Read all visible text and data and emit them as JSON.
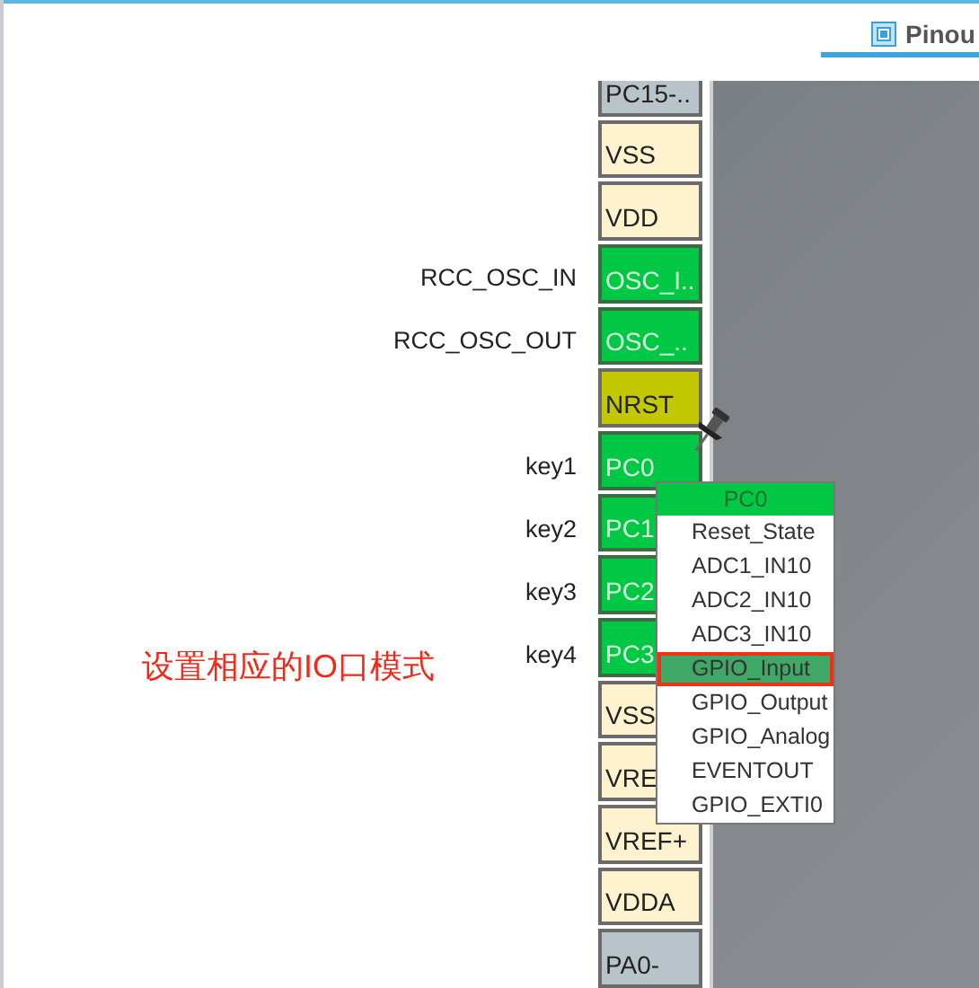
{
  "tab": {
    "label": "Pinou",
    "selected": true
  },
  "pins": [
    {
      "label": "PC15-..",
      "kind": "io"
    },
    {
      "label": "VSS",
      "kind": "power"
    },
    {
      "label": "VDD",
      "kind": "power"
    },
    {
      "label": "OSC_I..",
      "kind": "used",
      "signal": "RCC_OSC_IN"
    },
    {
      "label": "OSC_..",
      "kind": "used",
      "signal": "RCC_OSC_OUT"
    },
    {
      "label": "NRST",
      "kind": "reset"
    },
    {
      "label": "PC0",
      "kind": "used",
      "signal": "key1"
    },
    {
      "label": "PC1",
      "kind": "used",
      "signal": "key2"
    },
    {
      "label": "PC2",
      "kind": "used",
      "signal": "key3"
    },
    {
      "label": "PC3",
      "kind": "used",
      "signal": "key4"
    },
    {
      "label": "VSS",
      "kind": "power"
    },
    {
      "label": "VRE",
      "kind": "power"
    },
    {
      "label": "VREF+",
      "kind": "power"
    },
    {
      "label": "VDDA",
      "kind": "power"
    },
    {
      "label": "PA0-",
      "kind": "io"
    }
  ],
  "popup": {
    "title": "PC0",
    "items": [
      {
        "label": "Reset_State",
        "selected": false
      },
      {
        "label": "ADC1_IN10",
        "selected": false
      },
      {
        "label": "ADC2_IN10",
        "selected": false
      },
      {
        "label": "ADC3_IN10",
        "selected": false
      },
      {
        "label": "GPIO_Input",
        "selected": true
      },
      {
        "label": "GPIO_Output",
        "selected": false
      },
      {
        "label": "GPIO_Analog",
        "selected": false
      },
      {
        "label": "EVENTOUT",
        "selected": false
      },
      {
        "label": "GPIO_EXTI0",
        "selected": false
      }
    ]
  },
  "annotation": "设置相应的IO口模式"
}
